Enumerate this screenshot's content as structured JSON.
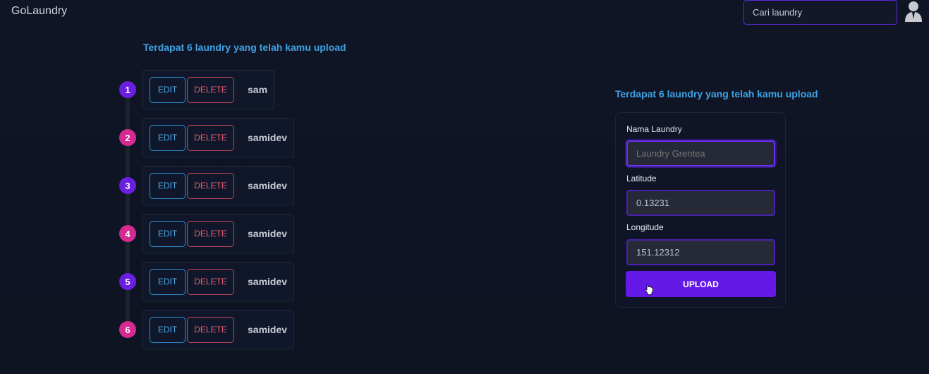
{
  "header": {
    "brand": "GoLaundry",
    "search_placeholder": "Cari laundry"
  },
  "list": {
    "heading": "Terdapat 6 laundry yang telah kamu upload",
    "edit_label": "EDIT",
    "delete_label": "DELETE",
    "items": [
      {
        "number": "1",
        "name": "sam",
        "badge_color": "#6a1ee0"
      },
      {
        "number": "2",
        "name": "samidev",
        "badge_color": "#d42a91"
      },
      {
        "number": "3",
        "name": "samidev",
        "badge_color": "#6a1ee0"
      },
      {
        "number": "4",
        "name": "samidev",
        "badge_color": "#d42a91"
      },
      {
        "number": "5",
        "name": "samidev",
        "badge_color": "#6a1ee0"
      },
      {
        "number": "6",
        "name": "samidev",
        "badge_color": "#d42a91"
      }
    ]
  },
  "form": {
    "heading": "Terdapat 6 laundry yang telah kamu upload",
    "name_label": "Nama Laundry",
    "name_placeholder": "Laundry Grentea",
    "lat_label": "Latitude",
    "lat_value": "0.13231",
    "lng_label": "Longitude",
    "lng_value": "151.12312",
    "upload_label": "UPLOAD"
  },
  "colors": {
    "accent": "#6419e6",
    "heading": "#3fa3e6",
    "edit": "#4fa8ea",
    "delete": "#e35f6f"
  }
}
